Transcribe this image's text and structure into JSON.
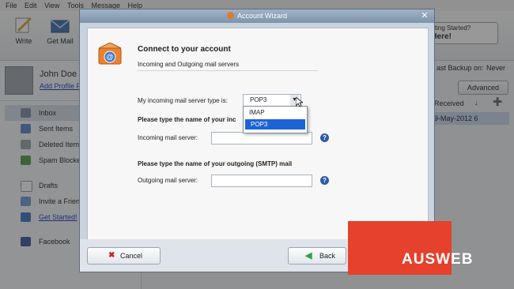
{
  "menu": [
    "File",
    "Edit",
    "View",
    "Tools",
    "Message",
    "Help"
  ],
  "toolbar": {
    "write": "Write",
    "get_mail": "Get Mail",
    "getting_started_line1": "Getting Started?",
    "getting_started_line2": "k Here!"
  },
  "profile": {
    "name": "John Doe",
    "add_photo": "Add Profile P"
  },
  "sidebar": {
    "items": [
      {
        "label": "Inbox"
      },
      {
        "label": "Sent Items"
      },
      {
        "label": "Deleted Item"
      },
      {
        "label": "Spam Blocke"
      },
      {
        "label": "Drafts"
      },
      {
        "label": "Invite a Frien"
      },
      {
        "label": "Get Started!"
      },
      {
        "label": "Facebook"
      }
    ]
  },
  "rightpane": {
    "backup": "ast Backup on:",
    "backup_value": "Never",
    "advanced": "Advanced",
    "received": "Received",
    "date": "9-May-2012 6"
  },
  "dialog": {
    "title": "Account Wizard",
    "heading": "Connect to your account",
    "subheading": "Incoming and Outgoing mail servers",
    "server_type_label": "My incoming mail server type is:",
    "server_type_value": "POP3",
    "options": [
      "IMAP",
      "POP3"
    ],
    "incoming_prompt": "Please type the name of your inc",
    "incoming_label": "Incoming mail server:",
    "outgoing_prompt": "Please type the name of your outgoing (SMTP) mail",
    "outgoing_label": "Outgoing mail server:",
    "cancel": "Cancel",
    "back": "Back"
  },
  "watermark": "AUSWEB",
  "colors": {
    "accent": "#1e63d6",
    "watermark_bg": "#e5412c"
  }
}
